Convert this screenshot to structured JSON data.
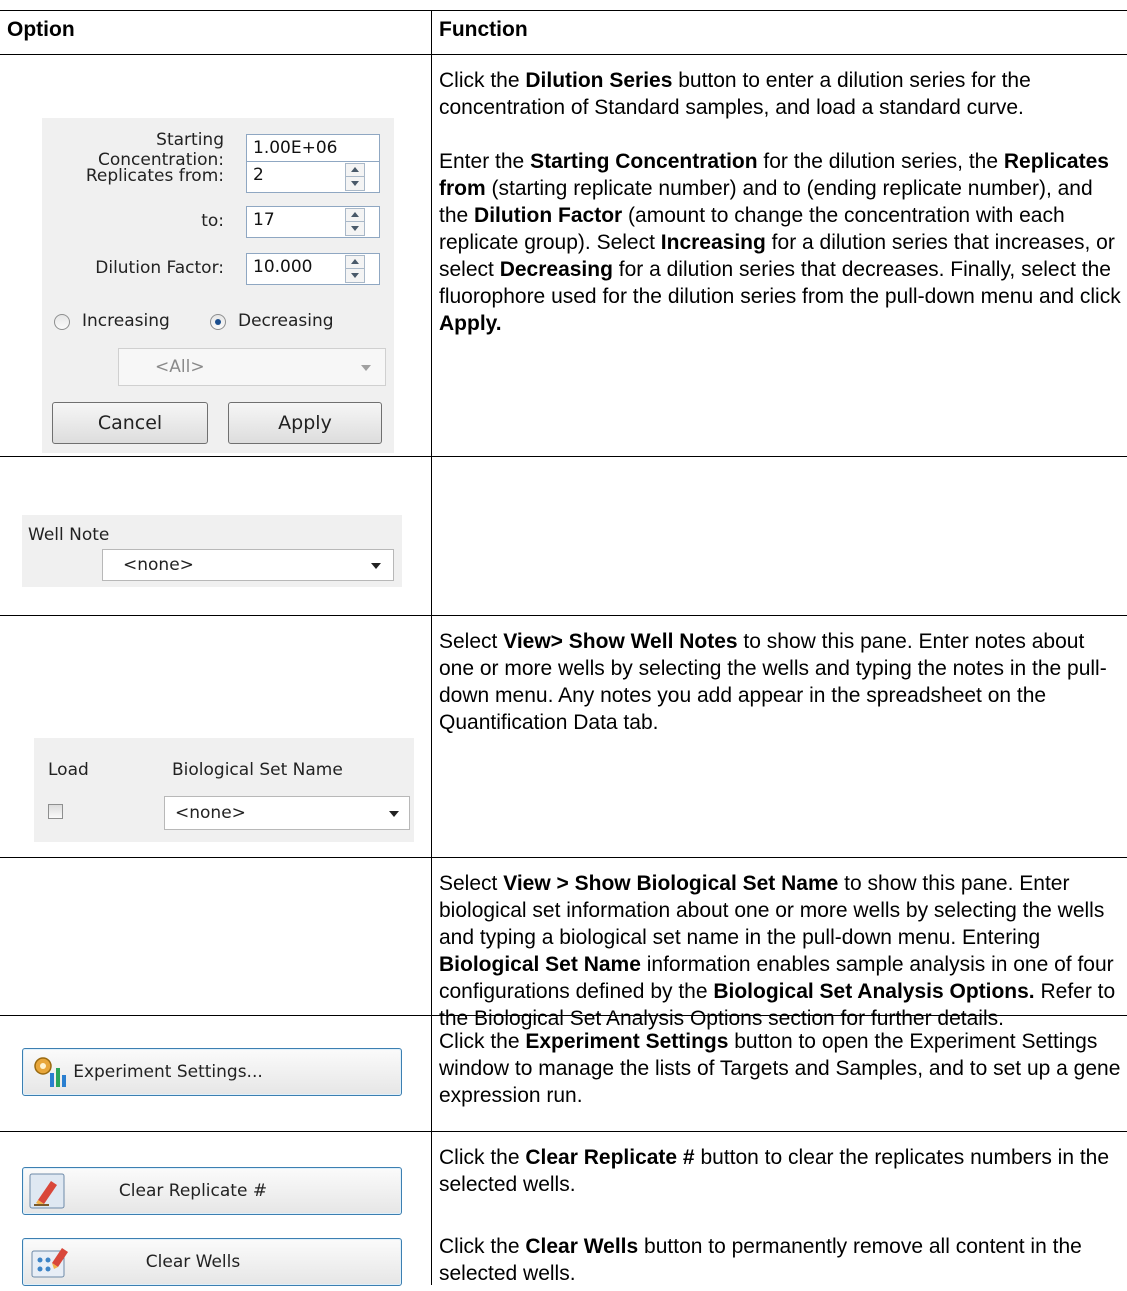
{
  "header": {
    "option": "Option",
    "function": "Function"
  },
  "dilution_panel": {
    "starting_label_1": "Starting",
    "starting_label_2": "Concentration:",
    "starting_value": "1.00E+06",
    "replicates_from_label": "Replicates from:",
    "replicates_from_value": "2",
    "to_label": "to:",
    "to_value": "17",
    "dilution_factor_label": "Dilution Factor:",
    "dilution_factor_value": "10.000",
    "increasing_label": "Increasing",
    "decreasing_label": "Decreasing",
    "selected_direction": "Decreasing",
    "fluorophore_value": "<All>",
    "cancel_label": "Cancel",
    "apply_label": "Apply"
  },
  "well_note_panel": {
    "label": "Well Note",
    "value": "<none>"
  },
  "bio_set_panel": {
    "load_label": "Load",
    "name_label": "Biological Set Name",
    "value": "<none>",
    "load_checked": false
  },
  "buttons": {
    "experiment_settings": "Experiment Settings...",
    "clear_replicate": "Clear Replicate #",
    "clear_wells": "Clear Wells"
  },
  "rows": {
    "dilution": {
      "p1": [
        {
          "t": "Click the "
        },
        {
          "t": "Dilution Series",
          "b": true
        },
        {
          "t": " button to enter a dilution series for the concentration of Standard samples, and load a standard curve."
        }
      ],
      "p2": [
        {
          "t": "Enter the "
        },
        {
          "t": "Starting Concentration",
          "b": true
        },
        {
          "t": " for the dilution series, the "
        },
        {
          "t": "Replicates from",
          "b": true
        },
        {
          "t": " (starting replicate number) and to (ending replicate number), and the "
        },
        {
          "t": "Dilution Factor",
          "b": true
        },
        {
          "t": " (amount to change the concentration with each replicate group). Select "
        },
        {
          "t": "Increasing",
          "b": true
        },
        {
          "t": " for a dilution series that increases, or select "
        },
        {
          "t": "Decreasing",
          "b": true
        },
        {
          "t": " for a dilution series that decreases. Finally, select the fluorophore used for the dilution series from the pull-down menu and click "
        },
        {
          "t": "Apply.",
          "b": true
        }
      ]
    },
    "well_note": [
      {
        "t": "Select "
      },
      {
        "t": "View> Show Well Notes",
        "b": true
      },
      {
        "t": " to show this pane. Enter notes about one or more wells by selecting the wells and typing the notes in the pull-down menu. Any notes you add appear in the spreadsheet on the Quantification Data tab."
      }
    ],
    "bio_set": [
      {
        "t": "Select "
      },
      {
        "t": "View > Show Biological Set Name",
        "b": true
      },
      {
        "t": " to show this pane. Enter biological set information about one or more wells by selecting the wells and typing a biological set name in the pull-down menu. Entering "
      },
      {
        "t": "Biological Set Name",
        "b": true
      },
      {
        "t": " information enables sample analysis in one of four configurations defined by the "
      },
      {
        "t": "Biological Set Analysis Options.",
        "b": true
      },
      {
        "t": " Refer to the Biological Set Analysis Options section for further details."
      }
    ],
    "experiment_settings": [
      {
        "t": "Click the "
      },
      {
        "t": "Experiment Settings",
        "b": true
      },
      {
        "t": " button to open the Experiment Settings window to manage the lists of Targets and Samples, and to set up a gene expression run."
      }
    ],
    "clear_replicate": [
      {
        "t": "Click the "
      },
      {
        "t": "Clear Replicate #",
        "b": true
      },
      {
        "t": " button to clear the replicates numbers in the selected wells."
      }
    ],
    "clear_wells": [
      {
        "t": "Click the "
      },
      {
        "t": "Clear Wells",
        "b": true
      },
      {
        "t": " button to permanently remove all content in the selected wells."
      }
    ]
  },
  "colors": {
    "panel_bg": "#f0f0f0",
    "button_border_blue": "#3c7fb1",
    "radio_dot": "#1b4e8e"
  },
  "icons": {
    "experiment_settings": "gear-chart-icon",
    "clear_replicate": "eraser-icon",
    "clear_wells": "plate-eraser-icon"
  }
}
